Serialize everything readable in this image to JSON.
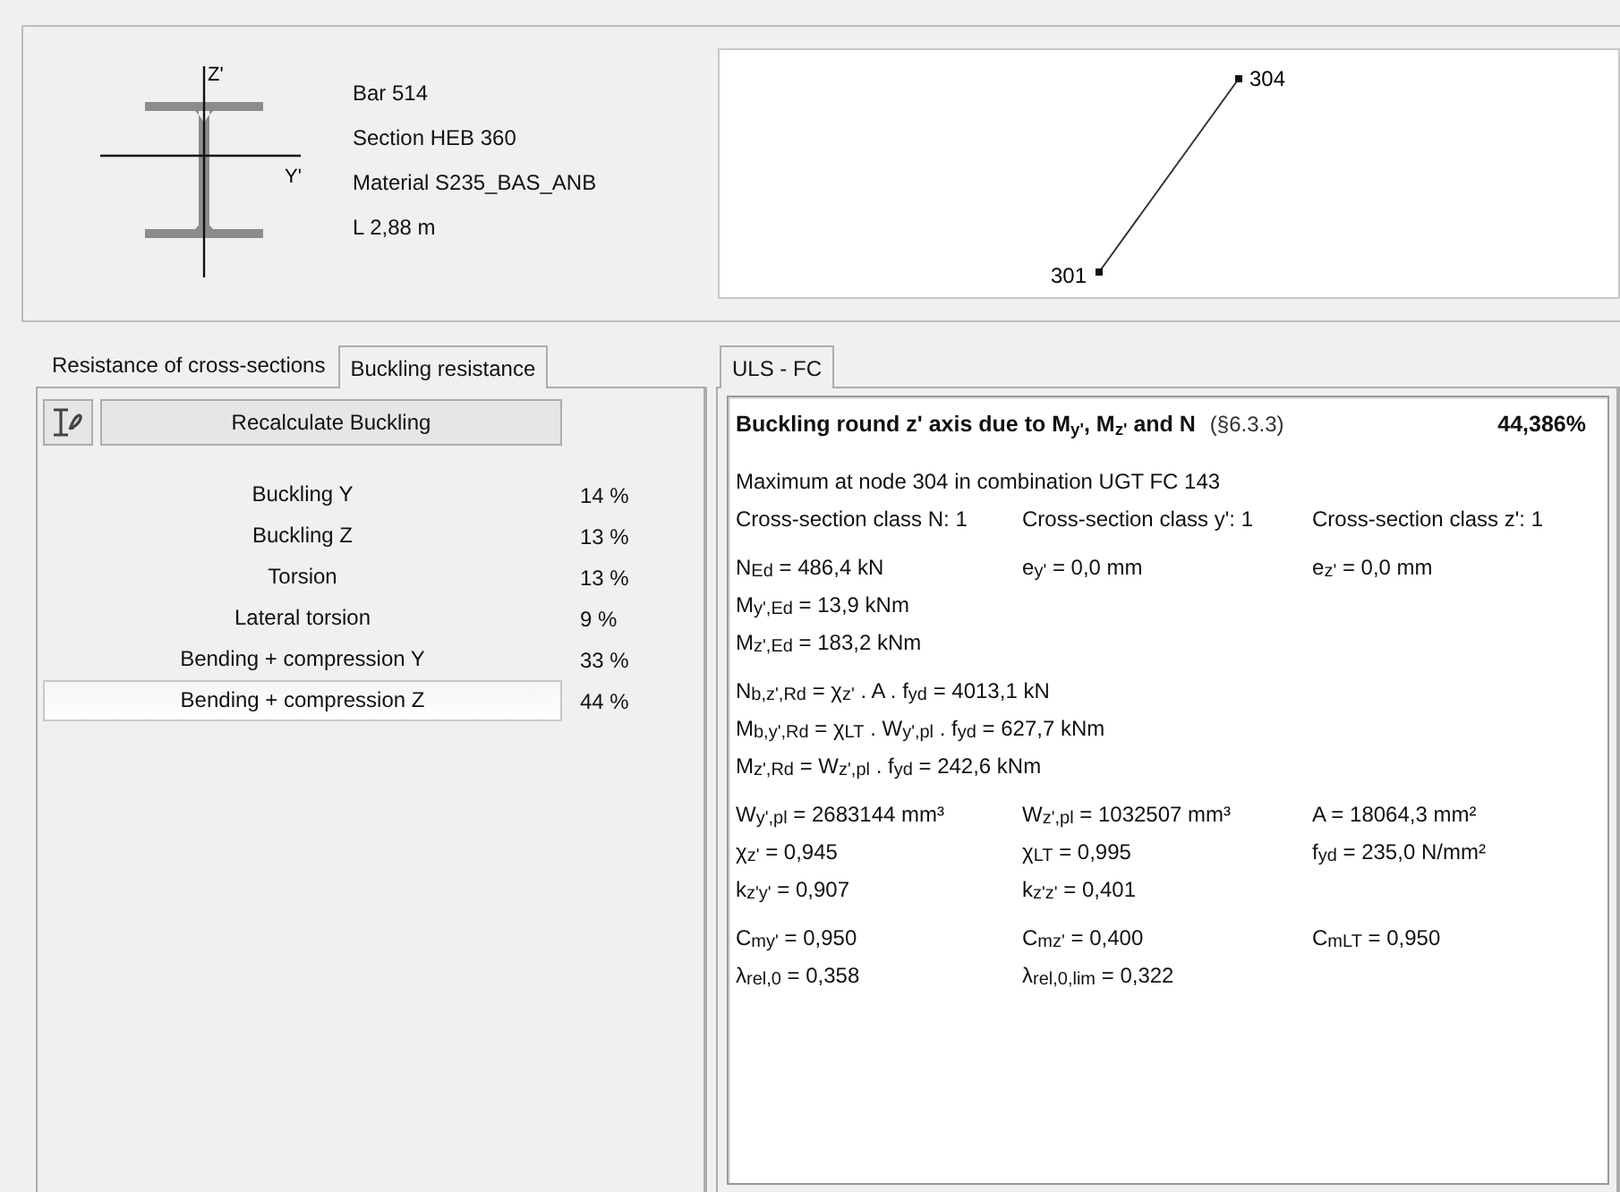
{
  "section": {
    "axis_z": "Z'",
    "axis_y": "Y'"
  },
  "info": [
    "Bar 514",
    "Section HEB 360",
    "Material S235_BAS_ANB",
    "L 2,88 m"
  ],
  "diagram": {
    "nodes": [
      {
        "label": "304"
      },
      {
        "label": "301"
      }
    ]
  },
  "left_tabs": [
    {
      "label": "Resistance of cross-sections",
      "selected": false
    },
    {
      "label": "Buckling resistance",
      "selected": true
    }
  ],
  "recalculate_button": "Recalculate Buckling",
  "results": [
    {
      "label": "Buckling Y",
      "value": "14 %",
      "selected": false
    },
    {
      "label": "Buckling Z",
      "value": "13 %",
      "selected": false
    },
    {
      "label": "Torsion",
      "value": "13 %",
      "selected": false
    },
    {
      "label": "Lateral torsion",
      "value": "9 %",
      "selected": false
    },
    {
      "label": "Bending + compression Y",
      "value": "33 %",
      "selected": false
    },
    {
      "label": "Bending + compression Z",
      "value": "44 %",
      "selected": true
    }
  ],
  "right_tabs": [
    {
      "label": "ULS - FC",
      "selected": true
    }
  ],
  "report": {
    "title": "Buckling round z' axis due to M$_{y'}$, M$_{z'}$ and N",
    "clause": "(§6.3.3)",
    "ratio": "44,386%",
    "blocks": [
      [
        [
          "Maximum at node 304 in combination UGT FC 143"
        ],
        [
          "Cross-section class N: 1",
          "Cross-section class y': 1",
          "Cross-section class z': 1"
        ]
      ],
      [
        [
          "N$_{Ed}$ = 486,4 kN",
          "e$_{y'}$ = 0,0 mm",
          "e$_{z'}$ = 0,0 mm"
        ],
        [
          "M$_{y',Ed}$ = 13,9 kNm"
        ],
        [
          "M$_{z',Ed}$ = 183,2 kNm"
        ]
      ],
      [
        [
          "N$_{b,z',Rd}$ = χ$_{z'}$ . A . f$_{yd}$ = 4013,1 kN"
        ],
        [
          "M$_{b,y',Rd}$ = χ$_{LT}$ . W$_{y',pl}$ . f$_{yd}$ = 627,7 kNm"
        ],
        [
          "M$_{z',Rd}$ = W$_{z',pl}$ . f$_{yd}$ = 242,6 kNm"
        ]
      ],
      [
        [
          "W$_{y',pl}$ = 2683144 mm³",
          "W$_{z',pl}$ = 1032507 mm³",
          "A = 18064,3 mm²"
        ],
        [
          "χ$_{z'}$ = 0,945",
          "χ$_{LT}$ = 0,995",
          "f$_{yd}$ = 235,0 N/mm²"
        ],
        [
          "k$_{z'y'}$ = 0,907",
          "k$_{z'z'}$ = 0,401"
        ]
      ],
      [
        [
          "C$_{my'}$ = 0,950",
          "C$_{mz'}$ = 0,400",
          "C$_{mLT}$ = 0,950"
        ],
        [
          "λ$_{rel,0}$ = 0,358",
          "λ$_{rel,0,lim}$ = 0,322"
        ]
      ]
    ]
  }
}
